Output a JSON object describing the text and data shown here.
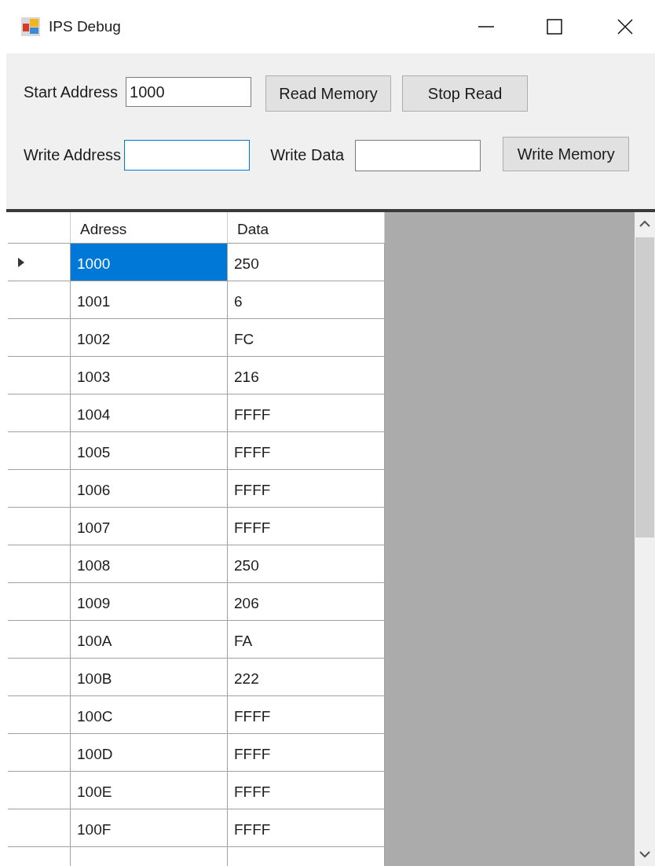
{
  "window": {
    "title": "IPS Debug"
  },
  "form": {
    "start_address": {
      "label": "Start Address",
      "value": "1000"
    },
    "read_button": "Read Memory",
    "stop_button": "Stop Read",
    "write_address": {
      "label": "Write Address",
      "focused": true
    },
    "write_data": {
      "label": "Write Data",
      "focused": false
    },
    "write_button": "Write Memory"
  },
  "grid": {
    "columns": [
      "Adress",
      "Data"
    ],
    "rows": [
      {
        "address": "1000",
        "data": "250",
        "selected": true
      },
      {
        "address": "1001",
        "data": "6",
        "selected": false
      },
      {
        "address": "1002",
        "data": "FC",
        "selected": false
      },
      {
        "address": "1003",
        "data": "216",
        "selected": false
      },
      {
        "address": "1004",
        "data": "FFFF",
        "selected": false
      },
      {
        "address": "1005",
        "data": "FFFF",
        "selected": false
      },
      {
        "address": "1006",
        "data": "FFFF",
        "selected": false
      },
      {
        "address": "1007",
        "data": "FFFF",
        "selected": false
      },
      {
        "address": "1008",
        "data": "250",
        "selected": false
      },
      {
        "address": "1009",
        "data": "206",
        "selected": false
      },
      {
        "address": "100A",
        "data": "FA",
        "selected": false
      },
      {
        "address": "100B",
        "data": "222",
        "selected": false
      },
      {
        "address": "100C",
        "data": "FFFF",
        "selected": false
      },
      {
        "address": "100D",
        "data": "FFFF",
        "selected": false
      },
      {
        "address": "100E",
        "data": "FFFF",
        "selected": false
      },
      {
        "address": "100F",
        "data": "FFFF",
        "selected": false
      }
    ]
  }
}
